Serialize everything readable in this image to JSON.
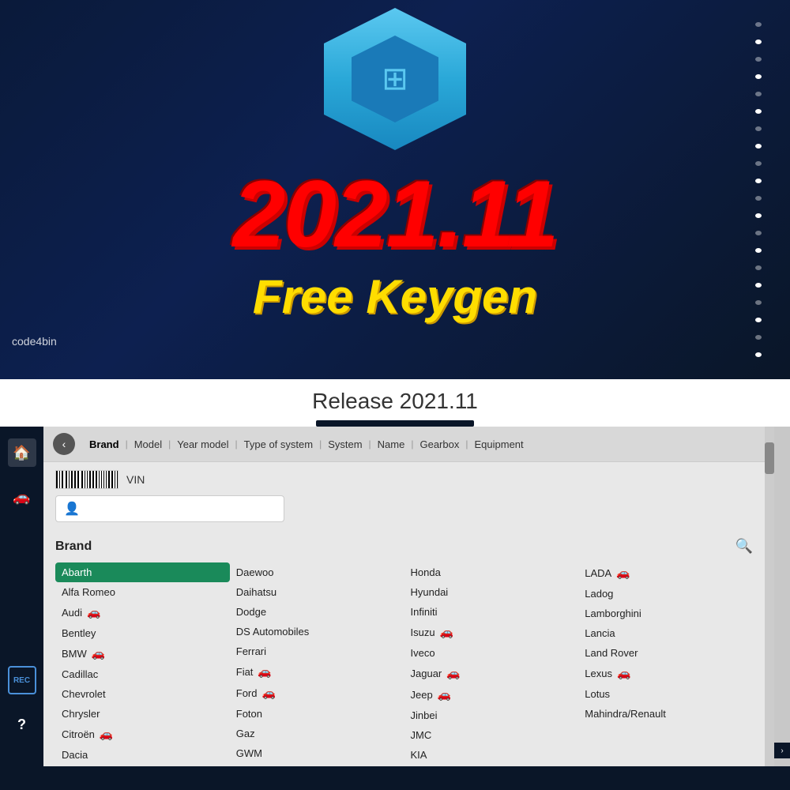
{
  "hero": {
    "version": "2021.11",
    "subtitle": "Free Keygen",
    "watermark": "code4bin",
    "hex_icon": "⚙"
  },
  "release_bar": {
    "title": "Release 2021.11"
  },
  "sidebar": {
    "home_icon": "🏠",
    "car_icon": "🚗",
    "rec_label": "REC",
    "help_icon": "?"
  },
  "breadcrumb": {
    "back_label": "‹",
    "items": [
      {
        "label": "Brand",
        "active": true
      },
      {
        "label": "Model",
        "active": false
      },
      {
        "label": "Year model",
        "active": false
      },
      {
        "label": "Type of system",
        "active": false
      },
      {
        "label": "System",
        "active": false
      },
      {
        "label": "Name",
        "active": false
      },
      {
        "label": "Gearbox",
        "active": false
      },
      {
        "label": "Equipment",
        "active": false
      }
    ]
  },
  "vin": {
    "label": "VIN",
    "search_placeholder": ""
  },
  "brand": {
    "title": "Brand",
    "search_icon": "🔍",
    "columns": [
      {
        "items": [
          {
            "name": "Abarth",
            "selected": true,
            "icon": false
          },
          {
            "name": "Alfa Romeo",
            "selected": false,
            "icon": false
          },
          {
            "name": "Audi",
            "selected": false,
            "icon": true
          },
          {
            "name": "Bentley",
            "selected": false,
            "icon": false
          },
          {
            "name": "BMW",
            "selected": false,
            "icon": true
          },
          {
            "name": "Cadillac",
            "selected": false,
            "icon": false
          },
          {
            "name": "Chevrolet",
            "selected": false,
            "icon": false
          },
          {
            "name": "Chrysler",
            "selected": false,
            "icon": false
          },
          {
            "name": "Citroën",
            "selected": false,
            "icon": true
          },
          {
            "name": "Dacia",
            "selected": false,
            "icon": false
          }
        ]
      },
      {
        "items": [
          {
            "name": "Daewoo",
            "selected": false,
            "icon": false
          },
          {
            "name": "Daihatsu",
            "selected": false,
            "icon": false
          },
          {
            "name": "Dodge",
            "selected": false,
            "icon": false
          },
          {
            "name": "DS Automobiles",
            "selected": false,
            "icon": false
          },
          {
            "name": "Ferrari",
            "selected": false,
            "icon": false
          },
          {
            "name": "Fiat",
            "selected": false,
            "icon": true
          },
          {
            "name": "Ford",
            "selected": false,
            "icon": true
          },
          {
            "name": "Foton",
            "selected": false,
            "icon": false
          },
          {
            "name": "Gaz",
            "selected": false,
            "icon": false
          },
          {
            "name": "GWM",
            "selected": false,
            "icon": false
          }
        ]
      },
      {
        "items": [
          {
            "name": "Honda",
            "selected": false,
            "icon": false
          },
          {
            "name": "Hyundai",
            "selected": false,
            "icon": false
          },
          {
            "name": "Infiniti",
            "selected": false,
            "icon": false
          },
          {
            "name": "Isuzu",
            "selected": false,
            "icon": true
          },
          {
            "name": "Iveco",
            "selected": false,
            "icon": false
          },
          {
            "name": "Jaguar",
            "selected": false,
            "icon": true
          },
          {
            "name": "Jeep",
            "selected": false,
            "icon": true
          },
          {
            "name": "Jinbei",
            "selected": false,
            "icon": false
          },
          {
            "name": "JMC",
            "selected": false,
            "icon": false
          },
          {
            "name": "KIA",
            "selected": false,
            "icon": false
          }
        ]
      },
      {
        "items": [
          {
            "name": "LADA",
            "selected": false,
            "icon": true
          },
          {
            "name": "Ladog",
            "selected": false,
            "icon": false
          },
          {
            "name": "Lamborghini",
            "selected": false,
            "icon": false
          },
          {
            "name": "Lancia",
            "selected": false,
            "icon": false
          },
          {
            "name": "Land Rover",
            "selected": false,
            "icon": false
          },
          {
            "name": "Lexus",
            "selected": false,
            "icon": true
          },
          {
            "name": "Lotus",
            "selected": false,
            "icon": false
          },
          {
            "name": "Mahindra/Renault",
            "selected": false,
            "icon": false
          }
        ]
      }
    ]
  },
  "colors": {
    "hero_bg": "#0a1628",
    "version_color": "#ff0000",
    "keygen_color": "#ffdd00",
    "selected_brand_bg": "#1a8a5a",
    "sidebar_bg": "#0a1628"
  }
}
